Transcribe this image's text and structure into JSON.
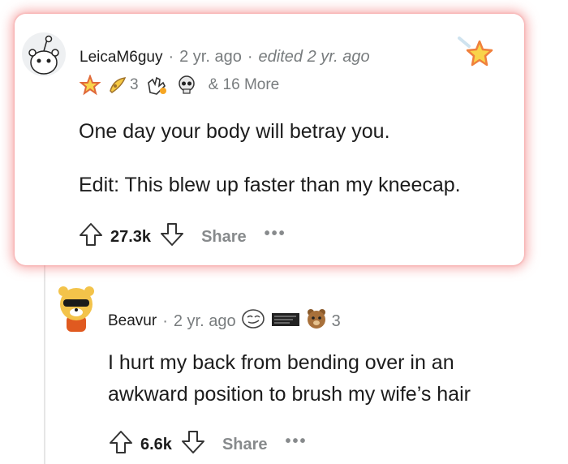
{
  "comments": [
    {
      "username": "LeicaM6guy",
      "age": "2 yr. ago",
      "edited": "edited 2 yr. ago",
      "award_count": "3",
      "more_awards": "& 16 More",
      "body": [
        "One day your body will betray you.",
        "Edit: This blew up faster than my kneecap."
      ],
      "score": "27.3k",
      "share_label": "Share",
      "more_label": "•••",
      "awards": [
        "star-award-icon",
        "party-award-icon",
        "clapping-award-icon",
        "skull-award-icon"
      ]
    },
    {
      "username": "Beavur",
      "age": "2 yr. ago",
      "award_count": "3",
      "body": [
        "I hurt my back from bending over in an",
        "awkward position to brush my wife’s hair"
      ],
      "score": "6.6k",
      "share_label": "Share",
      "more_label": "•••",
      "awards": [
        "face-award-icon",
        "text-award-icon",
        "bear-award-icon"
      ]
    }
  ],
  "colors": {
    "highlight_glow": "#f07070",
    "muted": "#787c7e",
    "award_gold": "#f7c340"
  }
}
